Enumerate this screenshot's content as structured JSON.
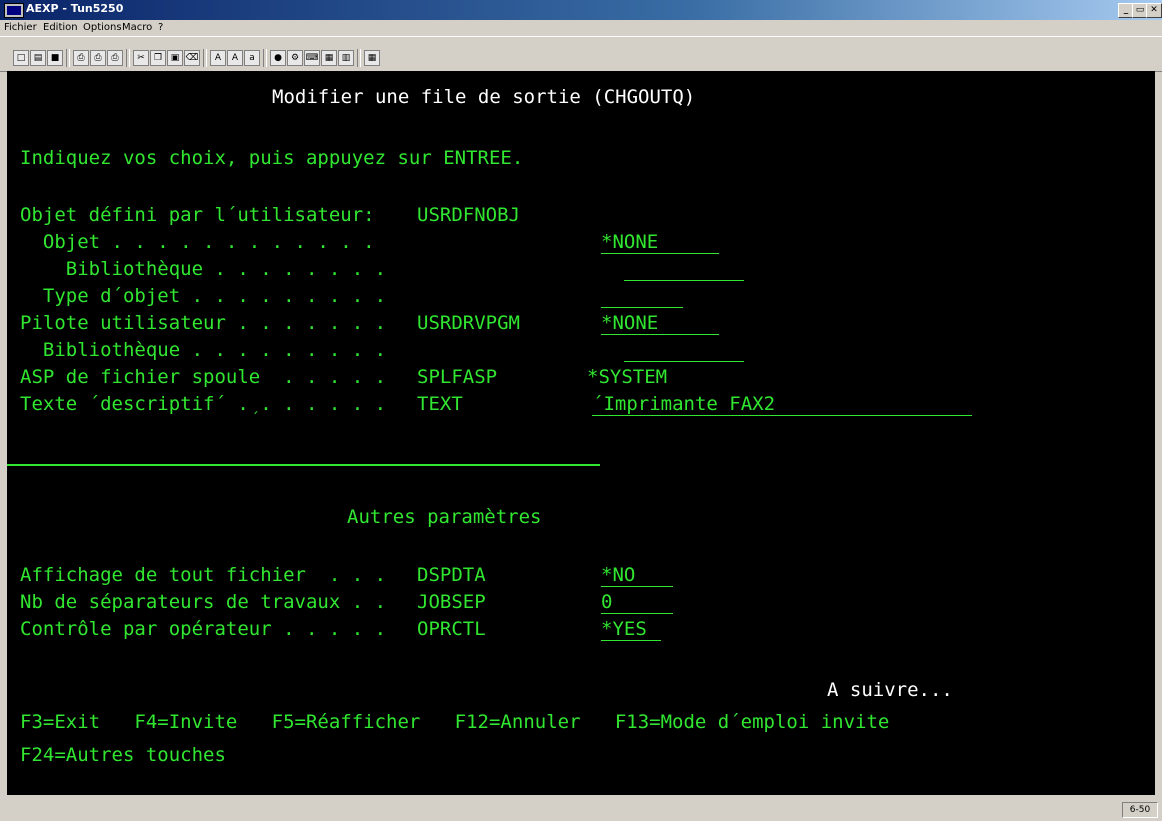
{
  "window": {
    "title": "AEXP - Tun5250",
    "controls": [
      "_",
      "̅",
      "×"
    ]
  },
  "menu": [
    "Fichier",
    "Edition",
    "Options",
    "Macro",
    "?"
  ],
  "toolbar": [
    "new-icon",
    "open-icon",
    "save-icon",
    "print-icon",
    "print-screen-icon",
    "print-setup-icon",
    "cut-icon",
    "copy-icon",
    "paste-icon",
    "erase-icon",
    "font-auto-icon",
    "font-large-icon",
    "font-small-icon",
    "colors-icon",
    "settings-icon",
    "keyboard-icon",
    "hotspots-icon",
    "properties-icon",
    "grid-icon"
  ],
  "screen": {
    "title": "Modifier une file de sortie (CHGOUTQ)",
    "instruction": "Indiquez vos choix, puis appuyez sur ENTREE.",
    "section1_header": "Objet défini par l´utilisateur:",
    "section1_kw": "USRDFNOBJ",
    "rows": [
      {
        "label": "  Objet . . . . . . . . . . . .",
        "kw": "",
        "value": "*NONE"
      },
      {
        "label": "    Bibliothèque . . . . . . . .",
        "kw": "",
        "value": ""
      },
      {
        "label": "  Type d´objet . . . . . . . . .",
        "kw": "",
        "value": ""
      },
      {
        "label": "Pilote utilisateur . . . . . . .",
        "kw": "USRDRVPGM",
        "value": "*NONE"
      },
      {
        "label": "  Bibliothèque . . . . . . . . .",
        "kw": "",
        "value": ""
      },
      {
        "label": "ASP de fichier spoule  . . . . .",
        "kw": "SPLFASP",
        "value": "*SYSTEM"
      },
      {
        "label": "Texte ´descriptif´ . . . . . . .",
        "kw": "TEXT",
        "value": "´Imprimante FAX2"
      }
    ],
    "section2_title": "Autres paramètres",
    "rows2": [
      {
        "label": "Affichage de tout fichier  . . .",
        "kw": "DSPDTA",
        "value": "*NO"
      },
      {
        "label": "Nb de séparateurs de travaux . .",
        "kw": "JOBSEP",
        "value": "0"
      },
      {
        "label": "Contrôle par opérateur . . . . .",
        "kw": "OPRCTL",
        "value": "*YES"
      }
    ],
    "more": "A suivre...",
    "fkeys_line1": "F3=Exit   F4=Invite   F5=Réafficher   F12=Annuler   F13=Mode d´emploi invite",
    "fkeys_line2": "F24=Autres touches"
  },
  "status": {
    "cursor": "6-50"
  }
}
